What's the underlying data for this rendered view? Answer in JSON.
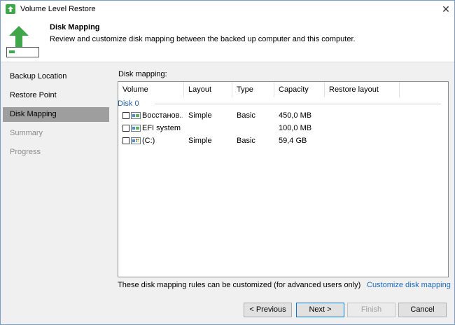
{
  "window": {
    "title": "Volume Level Restore"
  },
  "header": {
    "title": "Disk Mapping",
    "description": "Review and customize disk mapping between the backed up computer and this computer."
  },
  "sidebar": {
    "items": [
      {
        "label": "Backup Location",
        "state": "normal"
      },
      {
        "label": "Restore Point",
        "state": "normal"
      },
      {
        "label": "Disk Mapping",
        "state": "active"
      },
      {
        "label": "Summary",
        "state": "disabled"
      },
      {
        "label": "Progress",
        "state": "disabled"
      }
    ]
  },
  "main": {
    "section_label": "Disk mapping:",
    "table": {
      "columns": [
        "Volume",
        "Layout",
        "Type",
        "Capacity",
        "Restore layout"
      ],
      "group": "Disk 0",
      "rows": [
        {
          "volume": "Восстанов...",
          "layout": "Simple",
          "type": "Basic",
          "capacity": "450,0 MB",
          "restore_layout": "",
          "icon": "volume-icon"
        },
        {
          "volume": "EFI system ...",
          "layout": "",
          "type": "",
          "capacity": "100,0 MB",
          "restore_layout": "",
          "icon": "volume-icon"
        },
        {
          "volume": "(C:)",
          "layout": "Simple",
          "type": "Basic",
          "capacity": "59,4 GB",
          "restore_layout": "",
          "icon": "windows-volume-icon"
        }
      ]
    },
    "note": "These disk mapping rules can be customized (for advanced users only)",
    "customize_link": "Customize disk mapping"
  },
  "buttons": {
    "previous": "< Previous",
    "next": "Next >",
    "finish": "Finish",
    "cancel": "Cancel"
  },
  "colors": {
    "accent": "#0078d7",
    "link": "#1e6bbd",
    "active_step": "#9e9e9e",
    "header_arrow": "#3fa64a"
  }
}
